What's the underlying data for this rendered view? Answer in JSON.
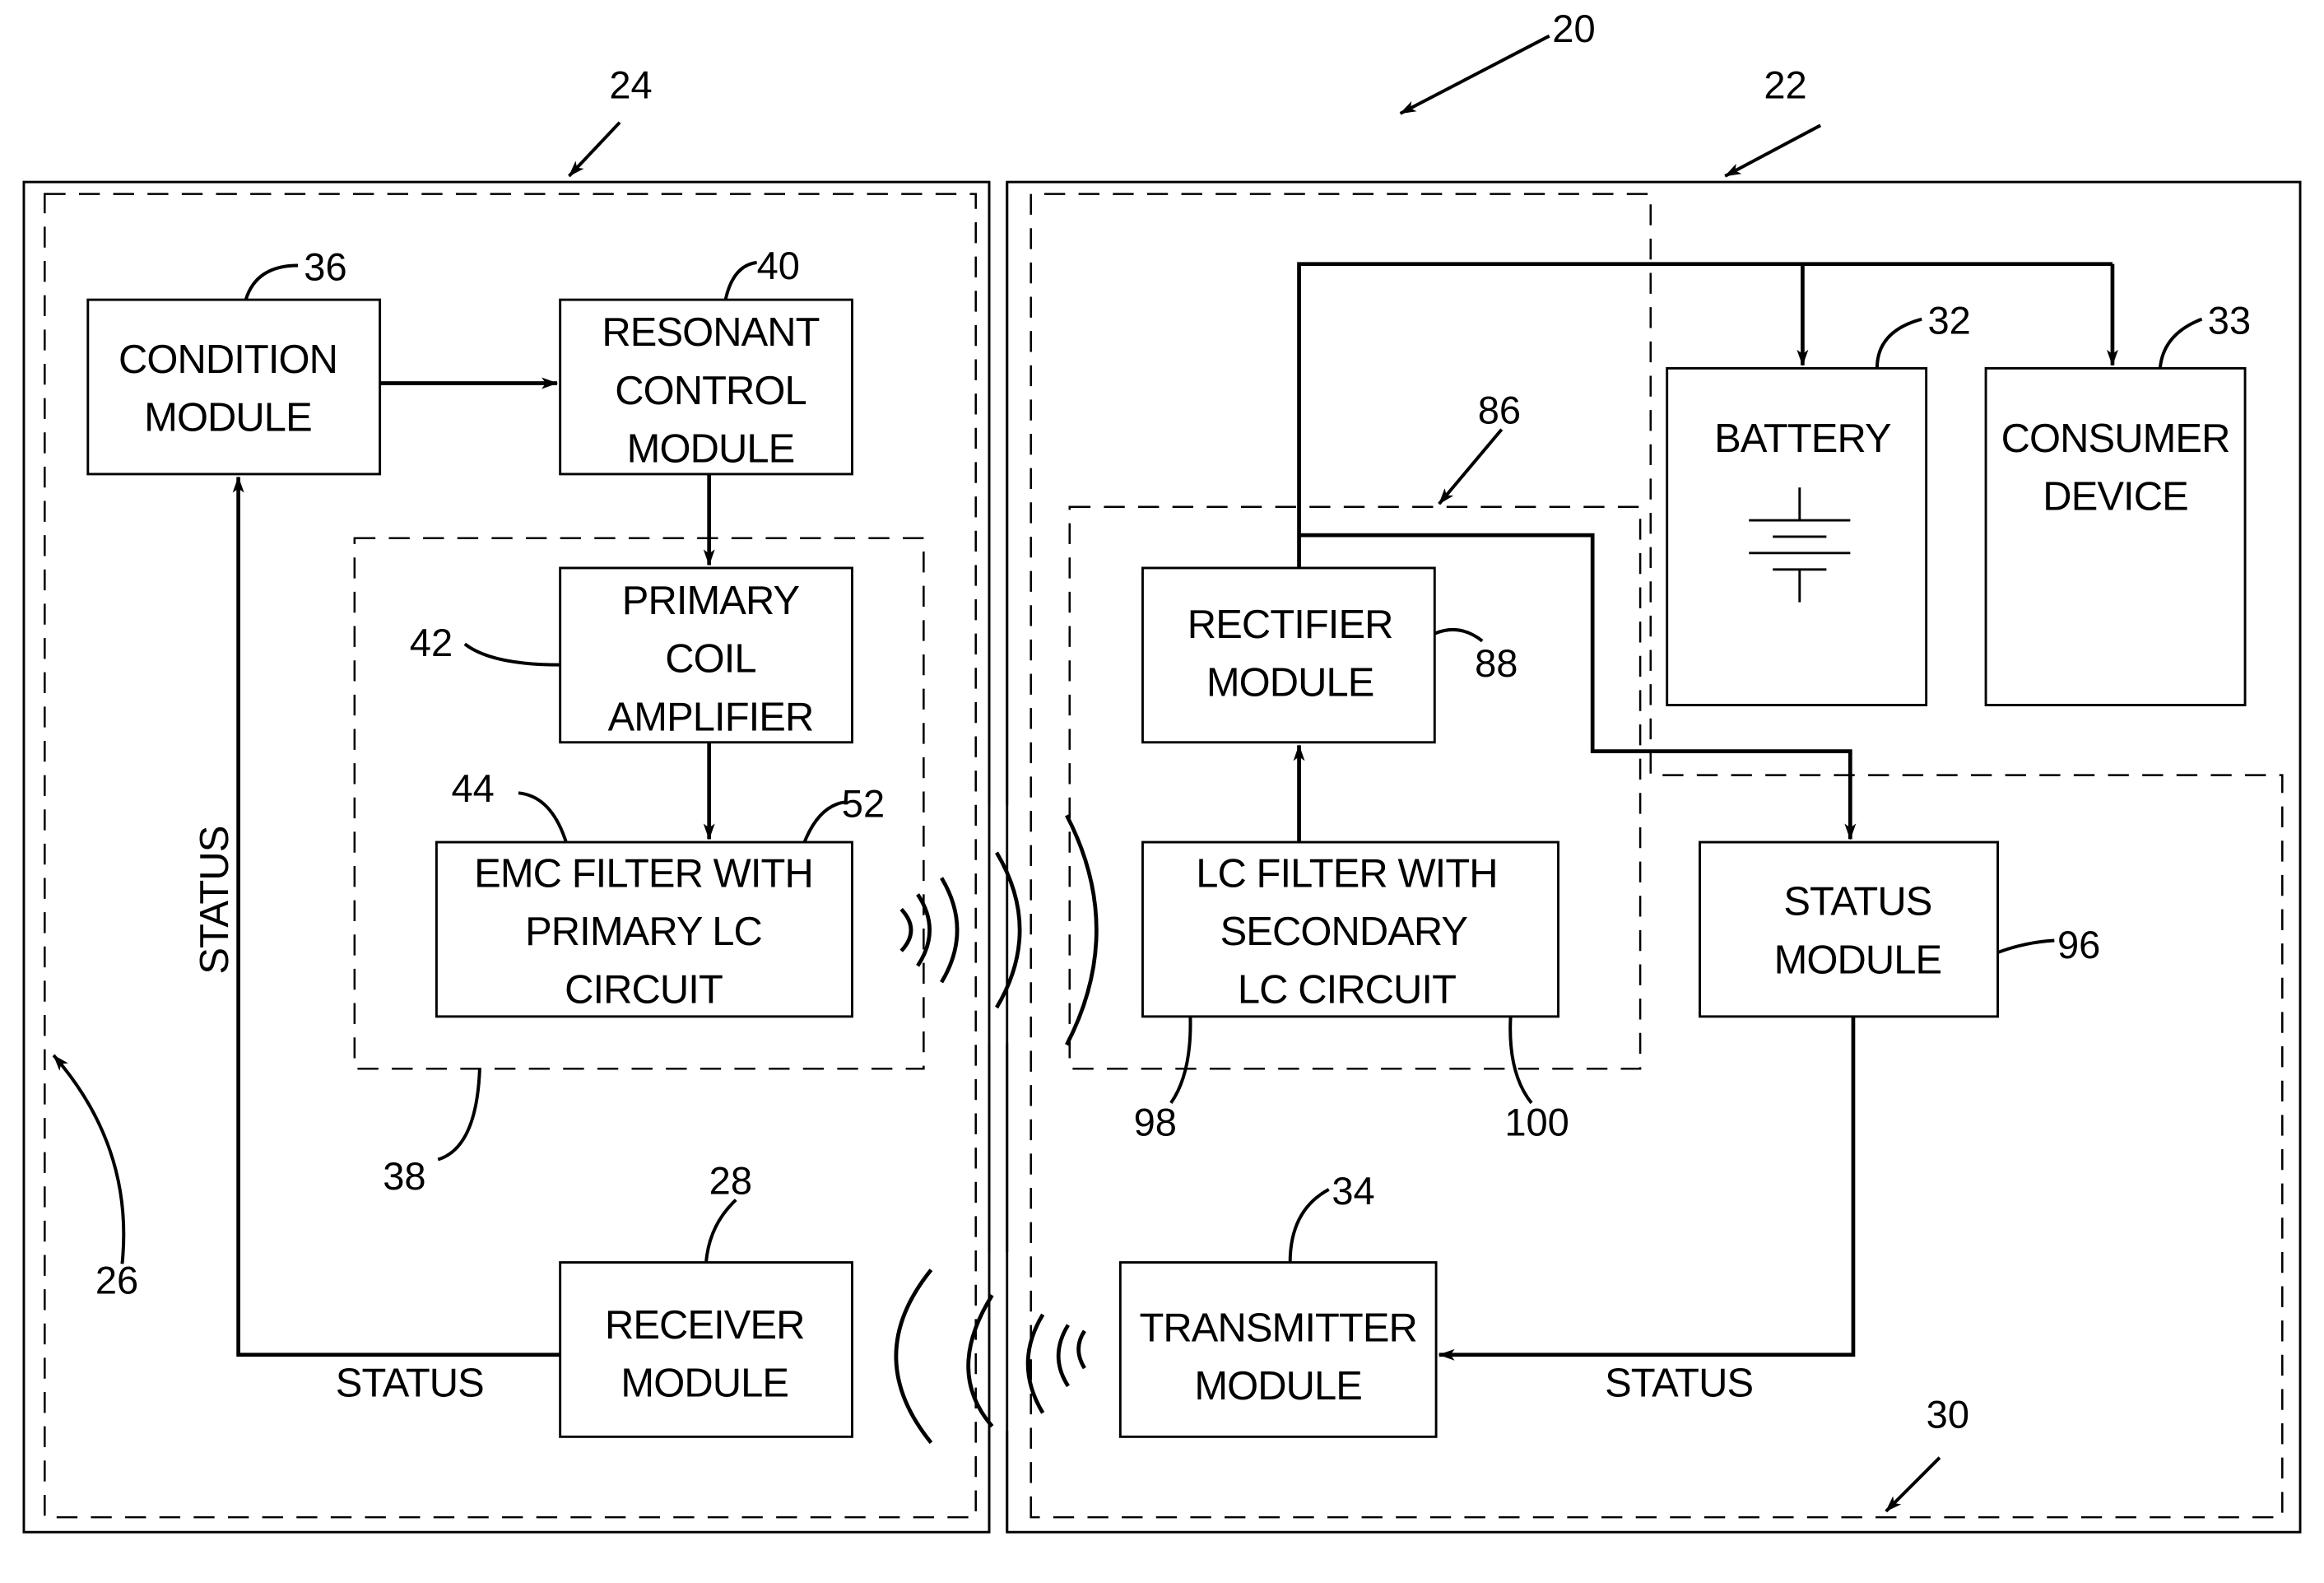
{
  "figure": {
    "reference_numerals": {
      "system": "20",
      "secondary_device": "22",
      "primary_device": "24",
      "feedback_loop": "26",
      "receiver": "28",
      "status_section": "30",
      "battery": "32",
      "consumer_device": "33",
      "transmitter": "34",
      "condition_module": "36",
      "primary_circuit_group": "38",
      "resonant_control": "40",
      "primary_coil_amplifier": "42",
      "emc_filter": "44",
      "primary_lc": "52",
      "secondary_circuit_group": "86",
      "rectifier": "88",
      "status_module": "96",
      "secondary_lc_a": "98",
      "secondary_lc_b": "100"
    },
    "blocks": {
      "condition_module": [
        "CONDITION",
        "MODULE"
      ],
      "resonant_control_module": [
        "RESONANT",
        "CONTROL",
        "MODULE"
      ],
      "primary_coil_amplifier": [
        "PRIMARY",
        "COIL",
        "AMPLIFIER"
      ],
      "emc_filter": [
        "EMC FILTER WITH",
        "PRIMARY LC",
        "CIRCUIT"
      ],
      "receiver_module": [
        "RECEIVER",
        "MODULE"
      ],
      "rectifier_module": [
        "RECTIFIER",
        "MODULE"
      ],
      "lc_filter": [
        "LC FILTER WITH",
        "SECONDARY",
        "LC CIRCUIT"
      ],
      "battery": [
        "BATTERY"
      ],
      "consumer_device": [
        "CONSUMER",
        "DEVICE"
      ],
      "status_module": [
        "STATUS",
        "MODULE"
      ],
      "transmitter_module": [
        "TRANSMITTER",
        "MODULE"
      ]
    },
    "signal_labels": {
      "status_vertical": "STATUS",
      "status_receiver": "STATUS",
      "status_transmitter": "STATUS"
    }
  }
}
